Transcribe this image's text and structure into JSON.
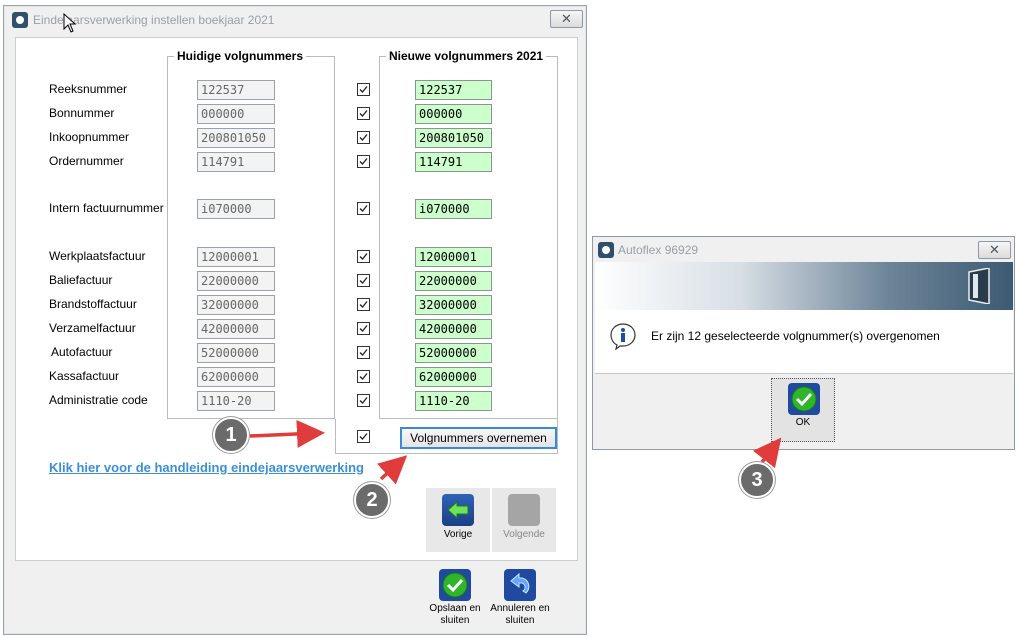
{
  "main_window": {
    "title": "Eindejaarsverwerking instellen boekjaar 2021",
    "close_glyph": "✕",
    "current_group_title": "Huidige volgnummers",
    "new_group_title": "Nieuwe volgnummers 2021",
    "rows": [
      {
        "label": "Reeksnummer",
        "current": "122537",
        "new": "122537",
        "checked": true
      },
      {
        "label": "Bonnummer",
        "current": "000000",
        "new": "000000",
        "checked": true
      },
      {
        "label": "Inkoopnummer",
        "current": "200801050",
        "new": "200801050",
        "checked": true
      },
      {
        "label": "Ordernummer",
        "current": "114791",
        "new": "114791",
        "checked": true
      },
      {
        "label": "Intern factuurnummer",
        "current": "i070000",
        "new": "i070000",
        "checked": true
      },
      {
        "label": "Werkplaatsfactuur",
        "current": "12000001",
        "new": "12000001",
        "checked": true
      },
      {
        "label": "Baliefactuur",
        "current": "22000000",
        "new": "22000000",
        "checked": true
      },
      {
        "label": "Brandstoffactuur",
        "current": "32000000",
        "new": "32000000",
        "checked": true
      },
      {
        "label": "Verzamelfactuur",
        "current": "42000000",
        "new": "42000000",
        "checked": true
      },
      {
        "label": "Autofactuur",
        "current": "52000000",
        "new": "52000000",
        "checked": true
      },
      {
        "label": "Kassafactuur",
        "current": "62000000",
        "new": "62000000",
        "checked": true
      },
      {
        "label": "Administratie code",
        "current": "1110-20",
        "new": "1110-20",
        "checked": true
      }
    ],
    "apply_button": "Volgnummers overnemen",
    "manual_link": "Klik hier voor de handleiding eindejaarsverwerking",
    "prev_button": "Vorige",
    "next_button": "Volgende",
    "save_button": "Opslaan en sluiten",
    "cancel_button": "Annuleren en sluiten"
  },
  "dialog": {
    "title": "Autoflex 96929",
    "close_glyph": "✕",
    "message": "Er zijn 12 geselecteerde volgnummer(s) overgenomen",
    "ok_button": "OK"
  },
  "annotations": [
    "1",
    "2",
    "3"
  ],
  "colors": {
    "new_field_bg": "#ccffcc",
    "link": "#3b8fd6",
    "arrow": "#e03c3c",
    "annotation_circle": "#6b6b6b"
  }
}
